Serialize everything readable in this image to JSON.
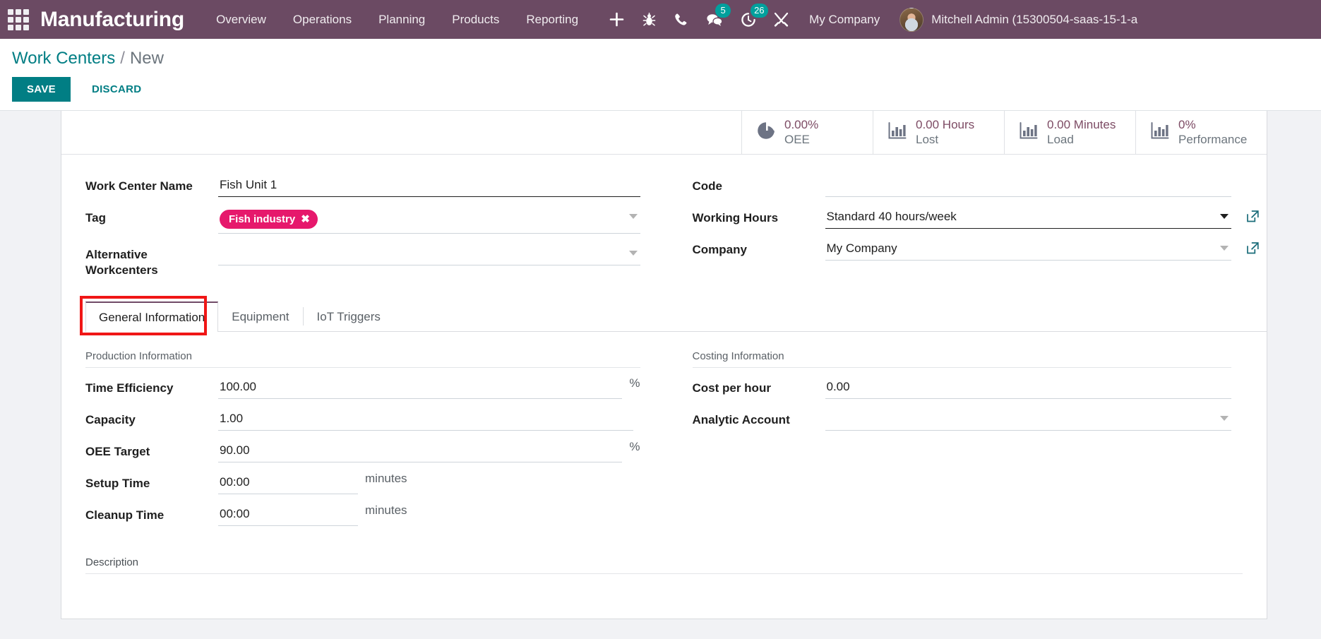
{
  "navbar": {
    "apps_icon": "apps-grid-icon",
    "brand": "Manufacturing",
    "menu": [
      {
        "label": "Overview"
      },
      {
        "label": "Operations"
      },
      {
        "label": "Planning"
      },
      {
        "label": "Products"
      },
      {
        "label": "Reporting"
      }
    ],
    "icons": [
      {
        "name": "plus-icon",
        "badge": null
      },
      {
        "name": "bug-icon",
        "badge": null
      },
      {
        "name": "phone-icon",
        "badge": null
      },
      {
        "name": "chat-icon",
        "badge": "5"
      },
      {
        "name": "activity-clock-icon",
        "badge": "26"
      },
      {
        "name": "tools-icon",
        "badge": null
      }
    ],
    "company": "My Company",
    "user_name": "Mitchell Admin (15300504-saas-15-1-a",
    "bg_color": "#6b4a63",
    "badge_color": "#00A09D"
  },
  "control_panel": {
    "breadcrumb_root": "Work Centers",
    "breadcrumb_separator": "/",
    "breadcrumb_current": "New",
    "save_label": "SAVE",
    "discard_label": "DISCARD",
    "save_color": "#017e84"
  },
  "stat_buttons": [
    {
      "icon": "pie-chart-icon",
      "value": "0.00%",
      "label": "OEE"
    },
    {
      "icon": "bar-chart-icon",
      "value": "0.00 Hours",
      "label": "Lost"
    },
    {
      "icon": "bar-chart-icon",
      "value": "0.00 Minutes",
      "label": "Load"
    },
    {
      "icon": "bar-chart-icon",
      "value": "0%",
      "label": "Performance"
    }
  ],
  "form": {
    "left": {
      "work_center_name_label": "Work Center Name",
      "work_center_name_value": "Fish Unit 1",
      "tag_label": "Tag",
      "tag_value": "Fish industry",
      "tag_remove": "✖",
      "tag_color": "#e6186c",
      "alternative_workcenters_label": "Alternative Workcenters",
      "alternative_workcenters_value": ""
    },
    "right": {
      "code_label": "Code",
      "code_value": "",
      "working_hours_label": "Working Hours",
      "working_hours_value": "Standard 40 hours/week",
      "company_label": "Company",
      "company_value": "My Company"
    }
  },
  "tabs": [
    {
      "label": "General Information",
      "active": true,
      "highlighted": true
    },
    {
      "label": "Equipment",
      "active": false,
      "highlighted": false
    },
    {
      "label": "IoT Triggers",
      "active": false,
      "highlighted": false
    }
  ],
  "general_information": {
    "production": {
      "section_title": "Production Information",
      "fields": [
        {
          "label": "Time Efficiency",
          "value": "100.00",
          "suffix": "%"
        },
        {
          "label": "Capacity",
          "value": "1.00",
          "suffix": ""
        },
        {
          "label": "OEE Target",
          "value": "90.00",
          "suffix": "%"
        },
        {
          "label": "Setup Time",
          "value": "00:00",
          "suffix": "minutes"
        },
        {
          "label": "Cleanup Time",
          "value": "00:00",
          "suffix": "minutes"
        }
      ]
    },
    "costing": {
      "section_title": "Costing Information",
      "fields": [
        {
          "label": "Cost per hour",
          "value": "0.00",
          "suffix": ""
        },
        {
          "label": "Analytic Account",
          "value": "",
          "suffix": ""
        }
      ]
    },
    "description_title": "Description"
  },
  "annotation": {
    "highlight_color": "#f01616"
  }
}
